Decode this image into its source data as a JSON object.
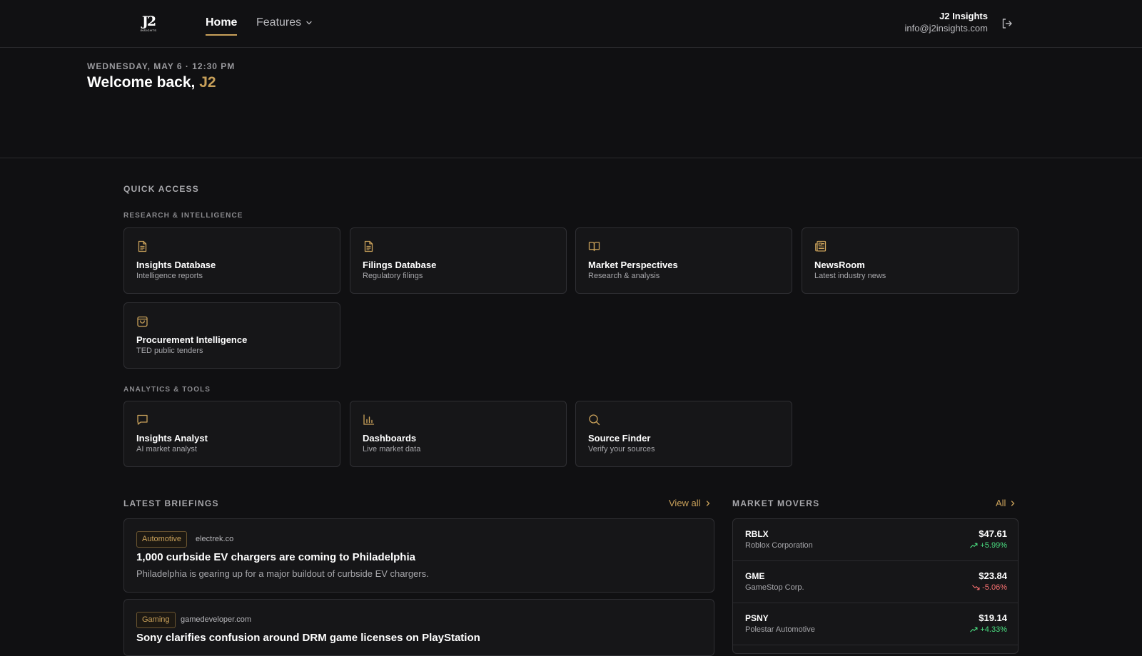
{
  "header": {
    "logo_mark": "J2",
    "logo_sub": "INSIGHTS",
    "nav": {
      "home": "Home",
      "features": "Features"
    },
    "user": {
      "name": "J2 Insights",
      "email": "info@j2insights.com"
    }
  },
  "welcome": {
    "date": "WEDNESDAY, MAY 6 · 12:30 PM",
    "greeting": "Welcome back,",
    "name": "J2"
  },
  "quick_access": {
    "title": "QUICK ACCESS",
    "research": {
      "title": "RESEARCH & INTELLIGENCE",
      "cards": [
        {
          "icon": "document-icon",
          "title": "Insights Database",
          "desc": "Intelligence reports"
        },
        {
          "icon": "document-icon",
          "title": "Filings Database",
          "desc": "Regulatory filings"
        },
        {
          "icon": "book-open-icon",
          "title": "Market Perspectives",
          "desc": "Research & analysis"
        },
        {
          "icon": "newspaper-icon",
          "title": "NewsRoom",
          "desc": "Latest industry news"
        },
        {
          "icon": "shopping-bag-icon",
          "title": "Procurement Intelligence",
          "desc": "TED public tenders"
        }
      ]
    },
    "analytics": {
      "title": "ANALYTICS & TOOLS",
      "cards": [
        {
          "icon": "chat-icon",
          "title": "Insights Analyst",
          "desc": "AI market analyst"
        },
        {
          "icon": "bar-chart-icon",
          "title": "Dashboards",
          "desc": "Live market data"
        },
        {
          "icon": "search-icon",
          "title": "Source Finder",
          "desc": "Verify your sources"
        }
      ]
    }
  },
  "briefings": {
    "title": "LATEST BRIEFINGS",
    "view_all": "View all",
    "items": [
      {
        "tag": "Automotive",
        "source": "electrek.co",
        "headline": "1,000 curbside EV chargers are coming to Philadelphia",
        "summary": "Philadelphia is gearing up for a major buildout of curbside EV chargers."
      },
      {
        "tag": "Gaming",
        "source": "gamedeveloper.com",
        "headline": "Sony clarifies confusion around DRM game licenses on PlayStation"
      }
    ]
  },
  "movers": {
    "title": "MARKET MOVERS",
    "all": "All",
    "items": [
      {
        "ticker": "RBLX",
        "company": "Roblox Corporation",
        "price": "$47.61",
        "change": "+5.99%",
        "direction": "up"
      },
      {
        "ticker": "GME",
        "company": "GameStop Corp.",
        "price": "$23.84",
        "change": "-5.06%",
        "direction": "down"
      },
      {
        "ticker": "PSNY",
        "company": "Polestar Automotive",
        "price": "$19.14",
        "change": "+4.33%",
        "direction": "up"
      }
    ]
  },
  "colors": {
    "accent": "#c9a15a",
    "background": "#101012",
    "card": "#161618",
    "up": "#4ade80",
    "down": "#f87171"
  }
}
